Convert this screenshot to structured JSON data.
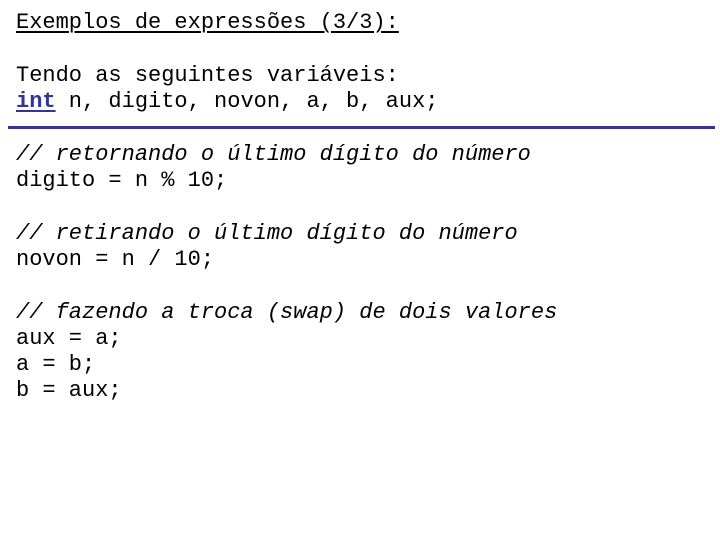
{
  "title": "Exemplos de expressões (3/3):",
  "intro": {
    "text": "Tendo as seguintes variáveis:",
    "declaration_keyword": "int",
    "declaration_rest": " n, digito, novon, a, b, aux;"
  },
  "colors": {
    "keyword": "#333399",
    "rule": "#333399",
    "text": "#000000"
  },
  "blocks": [
    {
      "comment": "// retornando o último dígito do número",
      "code": [
        "digito = n % 10;"
      ]
    },
    {
      "comment": "// retirando o último dígito do número",
      "code": [
        "novon = n / 10;"
      ]
    },
    {
      "comment": "// fazendo a troca (swap) de dois valores",
      "code": [
        "aux = a;",
        "a = b;",
        "b = aux;"
      ]
    }
  ]
}
